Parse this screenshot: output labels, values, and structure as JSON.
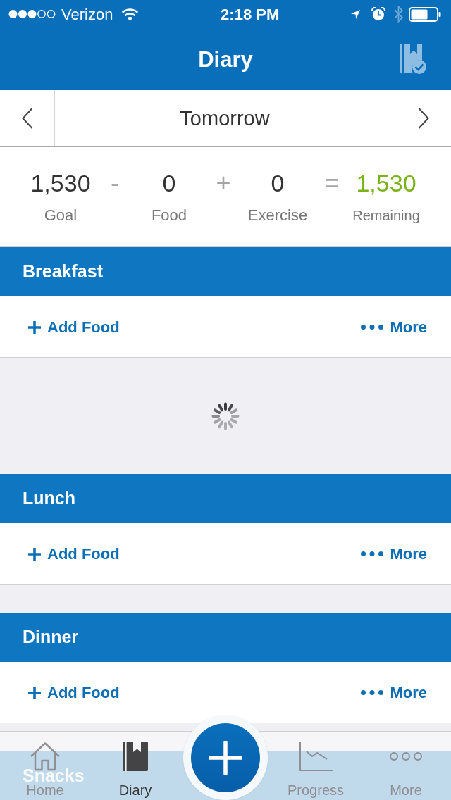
{
  "status_bar": {
    "carrier": "Verizon",
    "time": "2:18 PM"
  },
  "nav_bar": {
    "title": "Diary"
  },
  "date_nav": {
    "label": "Tomorrow"
  },
  "summary": [
    {
      "kind": "term",
      "value": "1,530",
      "label": "Goal"
    },
    {
      "kind": "operator",
      "symbol": "-"
    },
    {
      "kind": "term",
      "value": "0",
      "label": "Food"
    },
    {
      "kind": "operator",
      "symbol": "+"
    },
    {
      "kind": "term",
      "value": "0",
      "label": "Exercise"
    },
    {
      "kind": "operator",
      "symbol": "="
    },
    {
      "kind": "result",
      "value": "1,530",
      "label": "Remaining"
    }
  ],
  "meals": [
    {
      "name": "Breakfast",
      "add_label": "Add Food",
      "more_label": "More",
      "loading": true
    },
    {
      "name": "Lunch",
      "add_label": "Add Food",
      "more_label": "More",
      "loading": false
    },
    {
      "name": "Dinner",
      "add_label": "Add Food",
      "more_label": "More",
      "loading": false
    },
    {
      "name": "Snacks",
      "loading": false
    }
  ],
  "tab_bar": {
    "tabs": [
      {
        "label": "Home",
        "selected": false
      },
      {
        "label": "Diary",
        "selected": true
      },
      {
        "label": "Progress",
        "selected": false
      },
      {
        "label": "More",
        "selected": false
      }
    ]
  }
}
